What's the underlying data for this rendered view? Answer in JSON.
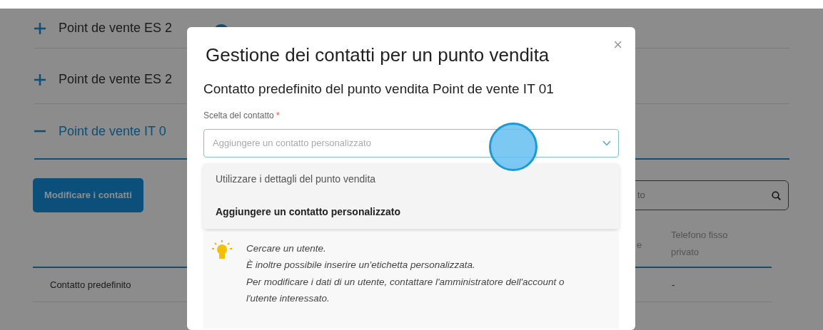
{
  "background": {
    "accordion": [
      {
        "label": "Point de vente ES 2",
        "expanded": false
      },
      {
        "label": "Point de vente ES 2",
        "expanded": false
      },
      {
        "label": "Point de vente IT 0",
        "expanded": true
      }
    ],
    "edit_button": "Modificare i contatti",
    "search": {
      "placeholder": "to"
    },
    "table": {
      "columns": [
        {
          "label": "e"
        },
        {
          "label": "Telefono fisso privato"
        }
      ],
      "rows": [
        {
          "cells": [
            "Contatto predefinito",
            "-"
          ]
        }
      ]
    }
  },
  "modal": {
    "title": "Gestione dei contatti per un punto vendita",
    "close": "×",
    "subtitle": "Contatto predefinito del punto vendita Point de vente IT 01",
    "field_label": "Scelta del contatto",
    "required_mark": "*",
    "select": {
      "placeholder": "Aggiungere un contatto personalizzato",
      "expanded": true
    },
    "options": [
      {
        "label": "Utilizzare i dettagli del punto vendita",
        "selected": false
      },
      {
        "label": "Aggiungere un contatto personalizzato",
        "selected": true
      }
    ],
    "hint_lines": [
      "Cercare un utente.",
      "È inoltre possibile inserire un'etichetta personalizzata.",
      "Per modificare i dati di un utente, contattare l'amministratore dell'account o",
      "l'utente interessato."
    ]
  }
}
